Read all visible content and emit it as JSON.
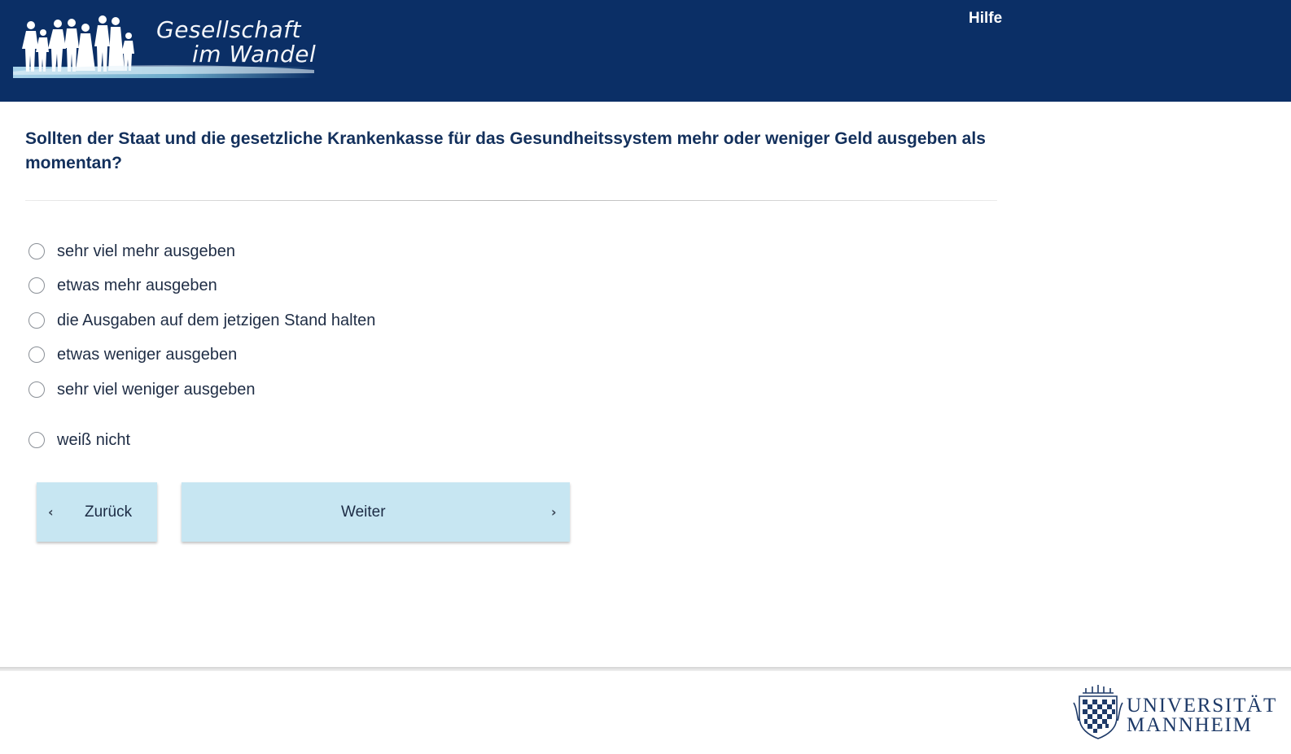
{
  "header": {
    "logo_line1": "Gesellschaft",
    "logo_line2": "im Wandel",
    "help_label": "Hilfe",
    "background_color": "#0b2f66"
  },
  "question": {
    "text": "Sollten der Staat und die gesetzliche Krankenkasse für das Gesundheitssystem mehr oder weniger Geld ausgeben als momentan?"
  },
  "options": [
    {
      "label": "sehr viel mehr ausgeben",
      "selected": false
    },
    {
      "label": "etwas mehr ausgeben",
      "selected": false
    },
    {
      "label": "die Ausgaben auf dem jetzigen Stand halten",
      "selected": false
    },
    {
      "label": "etwas weniger ausgeben",
      "selected": false
    },
    {
      "label": "sehr viel weniger ausgeben",
      "selected": false
    },
    {
      "label": "weiß nicht",
      "selected": false
    }
  ],
  "navigation": {
    "back_label": "Zurück",
    "next_label": "Weiter",
    "button_color": "#c7e6f2"
  },
  "footer": {
    "university_line1": "UNIVERSITÄT",
    "university_line2": "MANNHEIM"
  }
}
